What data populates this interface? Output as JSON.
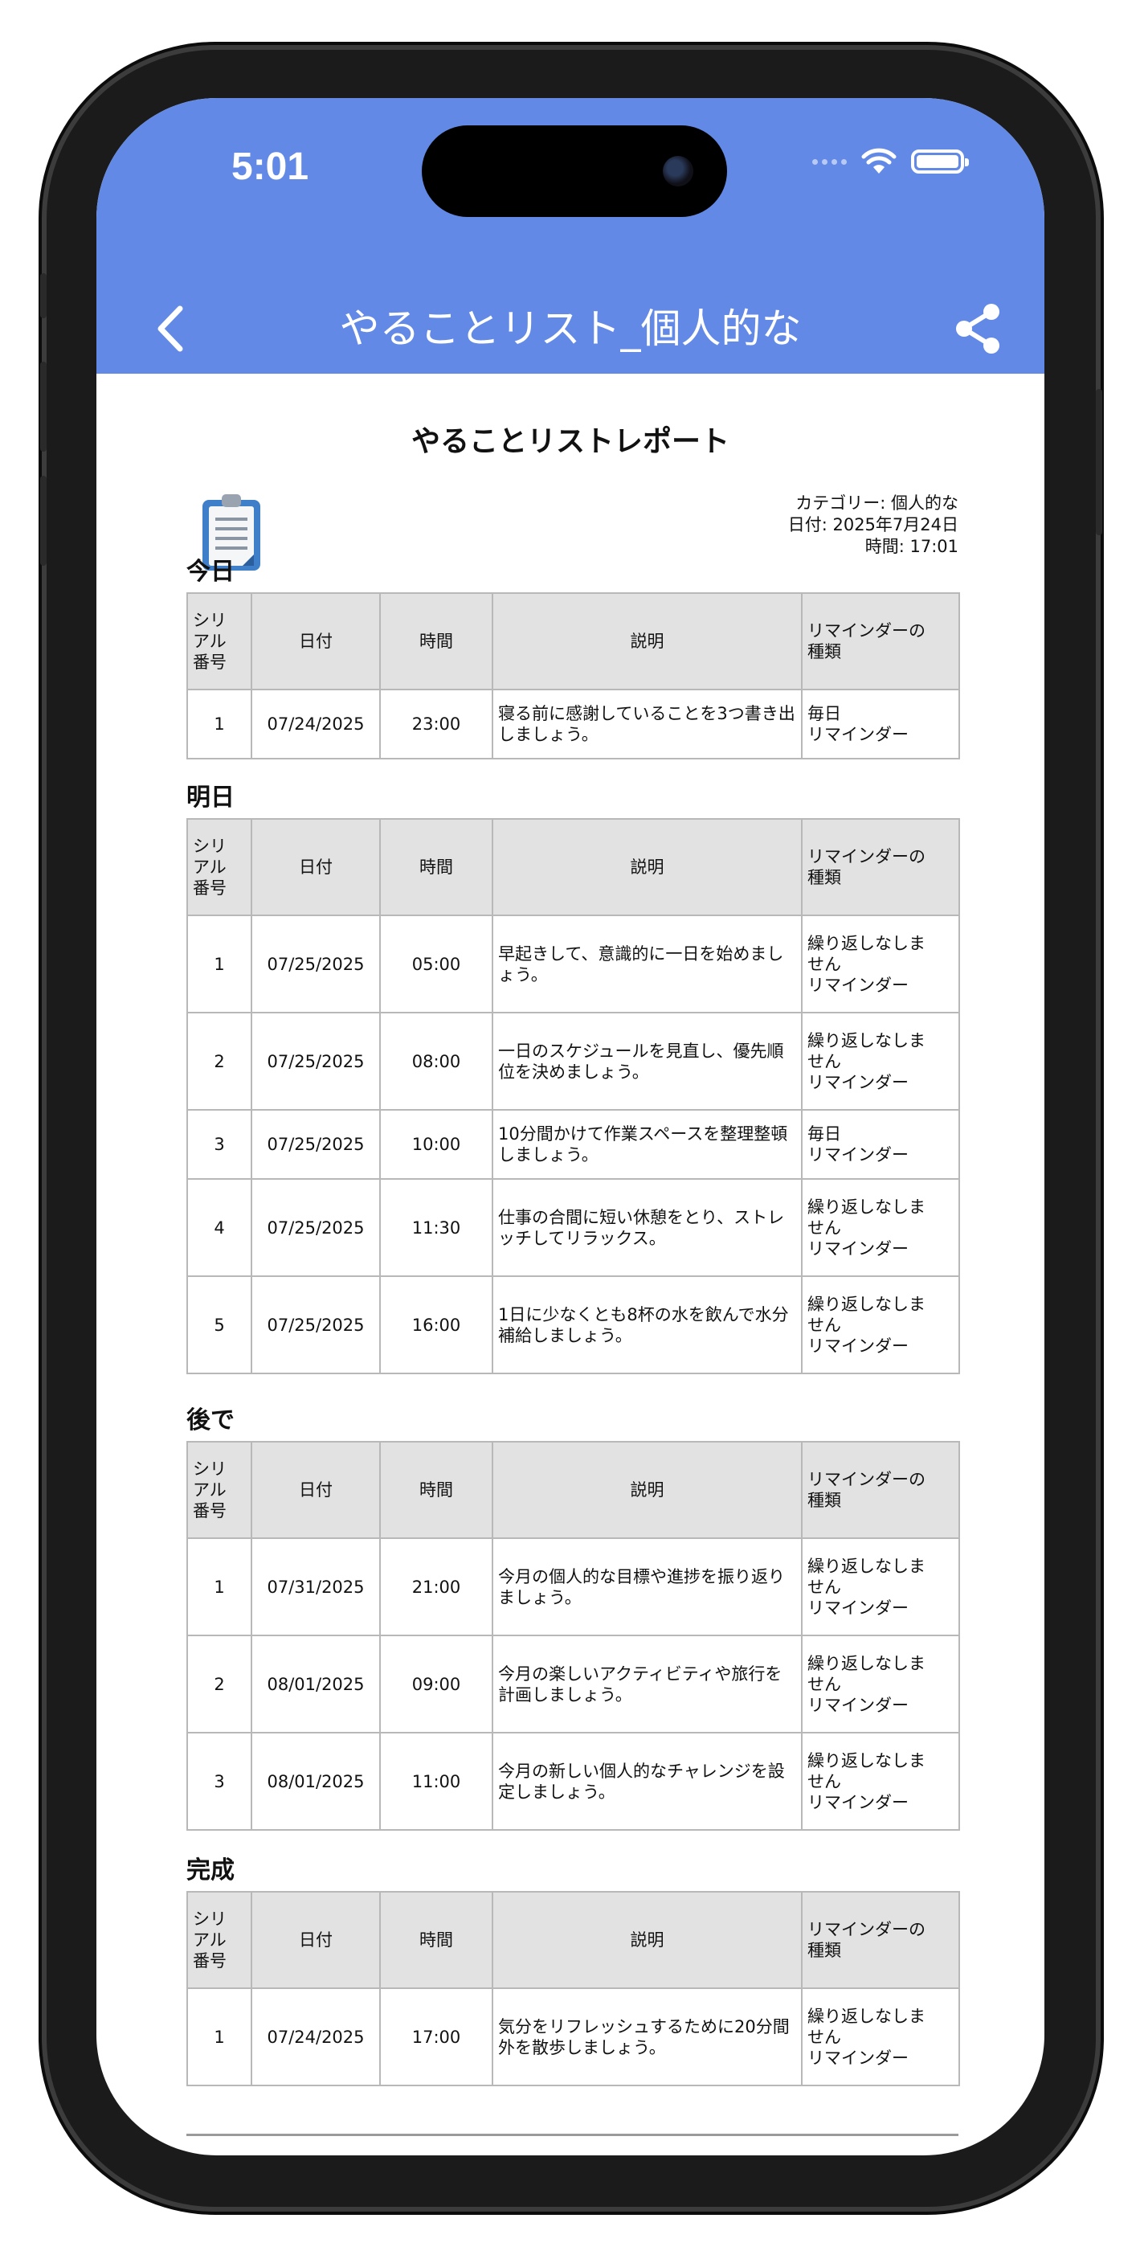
{
  "status_bar": {
    "time": "5:01"
  },
  "nav": {
    "title": "やることリスト_個人的な"
  },
  "report": {
    "title": "やることリストレポート",
    "category": "カテゴリー: 個人的な",
    "date": "日付: 2025年7月24日",
    "time": "時間: 17:01"
  },
  "table_headers": {
    "serial": [
      "シリ",
      "アル",
      "番号"
    ],
    "date": "日付",
    "time": "時間",
    "description": "説明",
    "reminder_type": [
      "リマインダーの",
      "種類"
    ]
  },
  "sections": [
    {
      "heading": "今日",
      "rows": [
        {
          "no": "1",
          "date": "07/24/2025",
          "time": "23:00",
          "desc": "寝る前に感謝していることを3つ書き出しましょう。",
          "reminder": [
            "毎日",
            "リマインダー"
          ]
        }
      ]
    },
    {
      "heading": "明日",
      "rows": [
        {
          "no": "1",
          "date": "07/25/2025",
          "time": "05:00",
          "desc": "早起きして、意識的に一日を始めましょう。",
          "reminder": [
            "繰り返しなしま",
            "せん",
            "リマインダー"
          ]
        },
        {
          "no": "2",
          "date": "07/25/2025",
          "time": "08:00",
          "desc": "一日のスケジュールを見直し、優先順位を決めましょう。",
          "reminder": [
            "繰り返しなしま",
            "せん",
            "リマインダー"
          ]
        },
        {
          "no": "3",
          "date": "07/25/2025",
          "time": "10:00",
          "desc": "10分間かけて作業スペースを整理整頓しましょう。",
          "reminder": [
            "毎日",
            "リマインダー"
          ]
        },
        {
          "no": "4",
          "date": "07/25/2025",
          "time": "11:30",
          "desc": "仕事の合間に短い休憩をとり、ストレッチしてリラックス。",
          "reminder": [
            "繰り返しなしま",
            "せん",
            "リマインダー"
          ]
        },
        {
          "no": "5",
          "date": "07/25/2025",
          "time": "16:00",
          "desc": "1日に少なくとも8杯の水を飲んで水分補給しましょう。",
          "reminder": [
            "繰り返しなしま",
            "せん",
            "リマインダー"
          ]
        }
      ]
    },
    {
      "heading": "後で",
      "rows": [
        {
          "no": "1",
          "date": "07/31/2025",
          "time": "21:00",
          "desc": "今月の個人的な目標や進捗を振り返りましょう。",
          "reminder": [
            "繰り返しなしま",
            "せん",
            "リマインダー"
          ]
        },
        {
          "no": "2",
          "date": "08/01/2025",
          "time": "09:00",
          "desc": "今月の楽しいアクティビティや旅行を計画しましょう。",
          "reminder": [
            "繰り返しなしま",
            "せん",
            "リマインダー"
          ]
        },
        {
          "no": "3",
          "date": "08/01/2025",
          "time": "11:00",
          "desc": "今月の新しい個人的なチャレンジを設定しましょう。",
          "reminder": [
            "繰り返しなしま",
            "せん",
            "リマインダー"
          ]
        }
      ]
    },
    {
      "heading": "完成",
      "rows": [
        {
          "no": "1",
          "date": "07/24/2025",
          "time": "17:00",
          "desc": "気分をリフレッシュするために20分間外を散歩しましょう。",
          "reminder": [
            "繰り返しなしま",
            "せん",
            "リマインダー"
          ]
        }
      ]
    }
  ],
  "icons": {
    "back": "chevron-left-icon",
    "share": "share-icon",
    "report": "clipboard-icon"
  },
  "colors": {
    "header_bg": "#6289e6",
    "table_header_bg": "#e2e2e2",
    "border": "#b8b8b8"
  }
}
